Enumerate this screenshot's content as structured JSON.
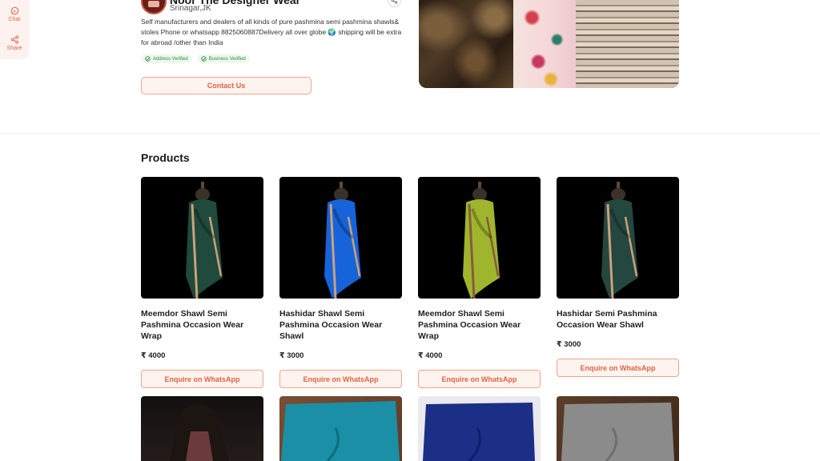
{
  "rail": {
    "chat_label": "Chat",
    "share_label": "Share"
  },
  "store": {
    "name": "Noor The Designer Wear",
    "location": "Srinagar,JK",
    "description": "Self manufacturers and dealers of all kinds of pure pashmina semi pashmina shawls& stoles Phone or whatsapp 8825060887Delivery all over globe 🌍 shipping will be extra for abroad /other than India",
    "badges": [
      "Address Verified",
      "Business Verified"
    ],
    "contact_label": "Contact Us"
  },
  "products": {
    "title": "Products",
    "enquire_label": "Enquire on WhatsApp",
    "items": [
      {
        "name": "Meemdor Shawl Semi Pashmina Occasion Wear Wrap",
        "price": "₹ 4000",
        "color": "#1f4a3c",
        "accent": "#c9a27a"
      },
      {
        "name": "Hashidar Shawl Semi Pashmina Occasion Wear Shawl",
        "price": "₹ 3000",
        "color": "#1763d9",
        "accent": "#c9a27a"
      },
      {
        "name": "Meemdor Shawl Semi Pashmina Occasion Wear Wrap",
        "price": "₹ 4000",
        "color": "#9fb52e",
        "accent": "#8a5a3a"
      },
      {
        "name": "Hashidar Semi Pashmina Occasion Wear Shawl",
        "price": "₹ 3000",
        "color": "#24473f",
        "accent": "#c9a27a"
      }
    ],
    "row2_colors": [
      "#1a1414",
      "#1b8fa6",
      "#1c2f86",
      "#8b8b8b"
    ]
  }
}
